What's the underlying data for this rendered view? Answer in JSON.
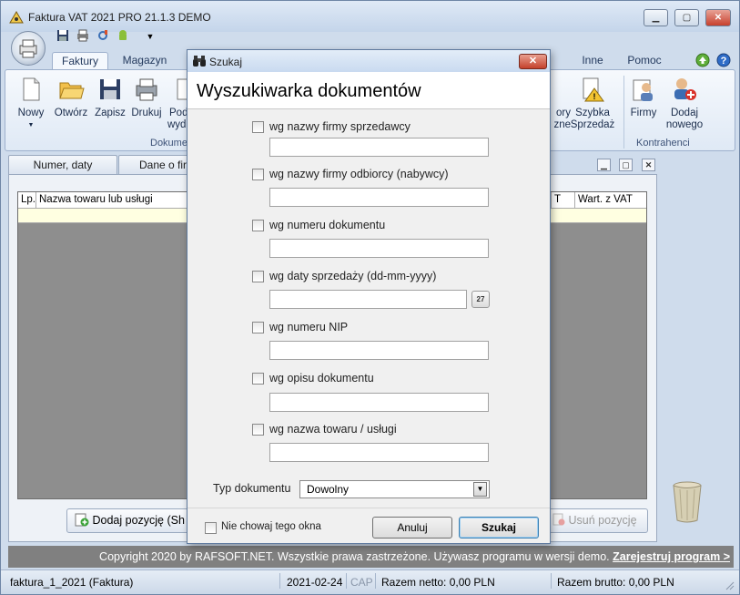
{
  "app": {
    "title": "Faktura VAT 2021 PRO 21.1.3 DEMO",
    "window_buttons": [
      "minimize",
      "maximize",
      "close"
    ]
  },
  "quick_access": {
    "icons": [
      "save-icon",
      "print-icon",
      "tools-icon",
      "android-icon",
      "dropdown-arrow-icon"
    ]
  },
  "ribbon": {
    "tabs": [
      "Faktury",
      "Magazyn",
      "Inne",
      "Pomoc"
    ],
    "active_tab": "Faktury",
    "buttons": {
      "nowy": "Nowy",
      "otworz": "Otwórz",
      "zapisz": "Zapisz",
      "drukuj": "Drukuj",
      "podglad_top": "Pod",
      "podglad_bottom": "wyd",
      "raporty_top": "ory",
      "raporty_bottom": "zne",
      "szybka_top": "Szybka",
      "szybka_bottom": "Sprzedaż",
      "firmy": "Firmy",
      "dodaj_top": "Dodaj",
      "dodaj_bottom": "nowego"
    },
    "groups": {
      "dokumenty": "Dokume",
      "kontrahenci": "Kontrahenci"
    }
  },
  "document_tabs": [
    "Numer, daty",
    "Dane o firm"
  ],
  "grid": {
    "columns": [
      "Lp.",
      "Nazwa towaru lub usługi",
      "T",
      "Wart. z VAT"
    ]
  },
  "bottom_buttons": {
    "add": "Dodaj pozycję (Sh",
    "remove": "Usuń pozycję"
  },
  "copyright": {
    "text": "Copyright 2020 by RAFSOFT.NET. Wszystkie prawa zastrzeżone. Używasz programu w wersji demo. ",
    "register": "Zarejestruj program >"
  },
  "statusbar": {
    "file": "faktura_1_2021 (Faktura)",
    "date": "2021-02-24",
    "cap": "CAP",
    "netto": "Razem netto: 0,00 PLN",
    "brutto": "Razem brutto: 0,00 PLN"
  },
  "dialog": {
    "title": "Szukaj",
    "heading": "Wyszukiwarka dokumentów",
    "criteria": [
      {
        "label": "wg nazwy firmy sprzedawcy",
        "value": ""
      },
      {
        "label": "wg nazwy firmy odbiorcy (nabywcy)",
        "value": ""
      },
      {
        "label": "wg numeru dokumentu",
        "value": ""
      },
      {
        "label": "wg daty sprzedaży (dd-mm-yyyy)",
        "value": ""
      },
      {
        "label": "wg numeru NIP",
        "value": ""
      },
      {
        "label": "wg opisu dokumentu",
        "value": ""
      },
      {
        "label": "wg nazwa towaru / usługi",
        "value": ""
      }
    ],
    "calendar_label": "27",
    "type_label": "Typ dokumentu",
    "type_value": "Dowolny",
    "no_hide_label": "Nie chowaj tego okna",
    "cancel": "Anuluj",
    "search": "Szukaj"
  },
  "colors": {
    "frame": "#cfdcec",
    "grid_bg": "#8e8e8e",
    "row_highlight": "#ffffe1",
    "copyright_bg": "#808080"
  }
}
